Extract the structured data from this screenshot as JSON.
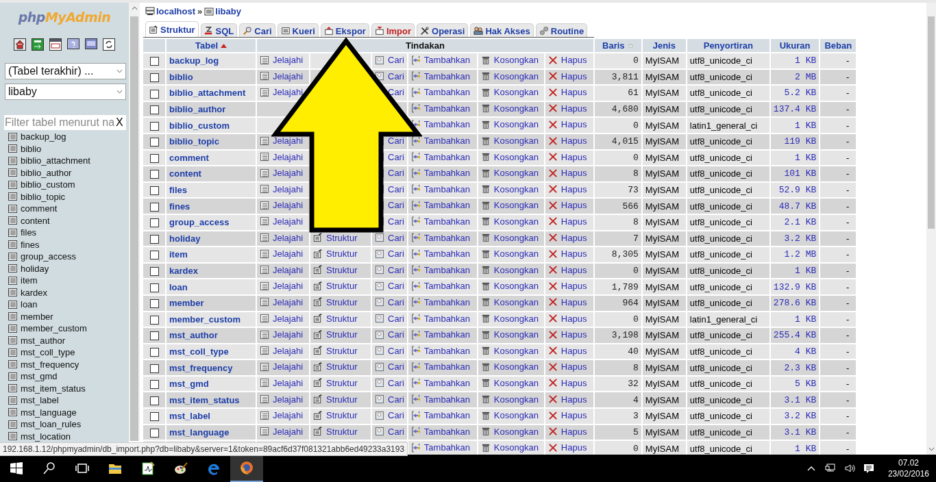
{
  "sidebar": {
    "logo": [
      "php",
      "MyAdmin"
    ],
    "recent_select": "(Tabel terakhir) ...",
    "database_select": "libaby",
    "filter": {
      "placeholder": "Filter tabel menurut na",
      "clear": "X"
    },
    "tables": [
      "backup_log",
      "biblio",
      "biblio_attachment",
      "biblio_author",
      "biblio_custom",
      "biblio_topic",
      "comment",
      "content",
      "files",
      "fines",
      "group_access",
      "holiday",
      "item",
      "kardex",
      "loan",
      "member",
      "member_custom",
      "mst_author",
      "mst_coll_type",
      "mst_frequency",
      "mst_gmd",
      "mst_item_status",
      "mst_label",
      "mst_language",
      "mst_loan_rules",
      "mst_location"
    ]
  },
  "breadcrumb": {
    "server": "localhost",
    "separator": "»",
    "database": "libaby"
  },
  "tabs": [
    {
      "label": "Struktur",
      "selected": true,
      "hovered": false
    },
    {
      "label": "SQL",
      "selected": false,
      "hovered": false
    },
    {
      "label": "Cari",
      "selected": false,
      "hovered": false
    },
    {
      "label": "Kueri",
      "selected": false,
      "hovered": false
    },
    {
      "label": "Ekspor",
      "selected": false,
      "hovered": false
    },
    {
      "label": "Impor",
      "selected": false,
      "hovered": true
    },
    {
      "label": "Operasi",
      "selected": false,
      "hovered": false
    },
    {
      "label": "Hak Akses",
      "selected": false,
      "hovered": false
    },
    {
      "label": "Routine",
      "selected": false,
      "hovered": false
    }
  ],
  "table": {
    "columns": {
      "table": "Tabel",
      "actions": "Tindakan",
      "rows": "Baris",
      "type": "Jenis",
      "collation": "Penyortiran",
      "size": "Ukuran",
      "overhead": "Beban"
    },
    "rows": [
      {
        "checked": false,
        "name": "backup_log",
        "browse": "Jelajahi",
        "search": "Cari",
        "insert": "Tambahkan",
        "empty": "Kosongkan",
        "drop": "Hapus",
        "rows": "0",
        "type": "MyISAM",
        "collation": "utf8_unicode_ci",
        "size": "1 KB",
        "overhead": "-"
      },
      {
        "checked": false,
        "name": "biblio",
        "browse": "Jelajahi",
        "search": "Cari",
        "insert": "Tambahkan",
        "empty": "Kosongkan",
        "drop": "Hapus",
        "rows": "3,811",
        "type": "MyISAM",
        "collation": "utf8_unicode_ci",
        "size": "2 MB",
        "overhead": "-"
      },
      {
        "checked": false,
        "name": "biblio_attachment",
        "browse": "Jelajahi",
        "search": "Cari",
        "insert": "Tambahkan",
        "empty": "Kosongkan",
        "drop": "Hapus",
        "rows": "61",
        "type": "MyISAM",
        "collation": "utf8_unicode_ci",
        "size": "5.2 KB",
        "overhead": "-"
      },
      {
        "checked": false,
        "name": "biblio_author",
        "insert": "Tambahkan",
        "empty": "Kosongkan",
        "drop": "Hapus",
        "rows": "4,680",
        "type": "MyISAM",
        "collation": "utf8_unicode_ci",
        "size": "137.4 KB",
        "overhead": "-"
      },
      {
        "checked": false,
        "name": "biblio_custom",
        "insert": "Tambahkan",
        "empty": "Kosongkan",
        "drop": "Hapus",
        "rows": "0",
        "type": "MyISAM",
        "collation": "latin1_general_ci",
        "size": "1 KB",
        "overhead": "-"
      },
      {
        "checked": false,
        "name": "biblio_topic",
        "browse": "Jelajahi",
        "search": "Cari",
        "insert": "Tambahkan",
        "empty": "Kosongkan",
        "drop": "Hapus",
        "rows": "4,015",
        "type": "MyISAM",
        "collation": "utf8_unicode_ci",
        "size": "119 KB",
        "overhead": "-"
      },
      {
        "checked": false,
        "name": "comment",
        "browse": "Jelajahi",
        "search": "Cari",
        "insert": "Tambahkan",
        "empty": "Kosongkan",
        "drop": "Hapus",
        "rows": "0",
        "type": "MyISAM",
        "collation": "utf8_unicode_ci",
        "size": "1 KB",
        "overhead": "-"
      },
      {
        "checked": false,
        "name": "content",
        "browse": "Jelajahi",
        "search": "Cari",
        "insert": "Tambahkan",
        "empty": "Kosongkan",
        "drop": "Hapus",
        "rows": "8",
        "type": "MyISAM",
        "collation": "utf8_unicode_ci",
        "size": "101 KB",
        "overhead": "-"
      },
      {
        "checked": false,
        "name": "files",
        "browse": "Jelajahi",
        "search": "Cari",
        "insert": "Tambahkan",
        "empty": "Kosongkan",
        "drop": "Hapus",
        "rows": "73",
        "type": "MyISAM",
        "collation": "utf8_unicode_ci",
        "size": "52.9 KB",
        "overhead": "-"
      },
      {
        "checked": false,
        "name": "fines",
        "browse": "Jelajahi",
        "search": "Cari",
        "insert": "Tambahkan",
        "empty": "Kosongkan",
        "drop": "Hapus",
        "rows": "566",
        "type": "MyISAM",
        "collation": "utf8_unicode_ci",
        "size": "48.7 KB",
        "overhead": "-"
      },
      {
        "checked": false,
        "name": "group_access",
        "browse": "Jelajahi",
        "search": "Cari",
        "insert": "Tambahkan",
        "empty": "Kosongkan",
        "drop": "Hapus",
        "rows": "8",
        "type": "MyISAM",
        "collation": "utf8_unicode_ci",
        "size": "2.1 KB",
        "overhead": "-"
      },
      {
        "checked": false,
        "name": "holiday",
        "browse": "Jelajahi",
        "structure": "Struktur",
        "search": "Cari",
        "insert": "Tambahkan",
        "empty": "Kosongkan",
        "drop": "Hapus",
        "rows": "7",
        "type": "MyISAM",
        "collation": "utf8_unicode_ci",
        "size": "3.2 KB",
        "overhead": "-"
      },
      {
        "checked": false,
        "name": "item",
        "browse": "Jelajahi",
        "structure": "Struktur",
        "search": "Cari",
        "insert": "Tambahkan",
        "empty": "Kosongkan",
        "drop": "Hapus",
        "rows": "8,305",
        "type": "MyISAM",
        "collation": "utf8_unicode_ci",
        "size": "1.2 MB",
        "overhead": "-"
      },
      {
        "checked": false,
        "name": "kardex",
        "browse": "Jelajahi",
        "structure": "Struktur",
        "search": "Cari",
        "insert": "Tambahkan",
        "empty": "Kosongkan",
        "drop": "Hapus",
        "rows": "0",
        "type": "MyISAM",
        "collation": "utf8_unicode_ci",
        "size": "1 KB",
        "overhead": "-"
      },
      {
        "checked": false,
        "name": "loan",
        "browse": "Jelajahi",
        "structure": "Struktur",
        "search": "Cari",
        "insert": "Tambahkan",
        "empty": "Kosongkan",
        "drop": "Hapus",
        "rows": "1,789",
        "type": "MyISAM",
        "collation": "utf8_unicode_ci",
        "size": "132.9 KB",
        "overhead": "-"
      },
      {
        "checked": false,
        "name": "member",
        "browse": "Jelajahi",
        "structure": "Struktur",
        "search": "Cari",
        "insert": "Tambahkan",
        "empty": "Kosongkan",
        "drop": "Hapus",
        "rows": "964",
        "type": "MyISAM",
        "collation": "utf8_unicode_ci",
        "size": "278.6 KB",
        "overhead": "-"
      },
      {
        "checked": false,
        "name": "member_custom",
        "browse": "Jelajahi",
        "structure": "Struktur",
        "search": "Cari",
        "insert": "Tambahkan",
        "empty": "Kosongkan",
        "drop": "Hapus",
        "rows": "0",
        "type": "MyISAM",
        "collation": "latin1_general_ci",
        "size": "1 KB",
        "overhead": "-"
      },
      {
        "checked": false,
        "name": "mst_author",
        "browse": "Jelajahi",
        "structure": "Struktur",
        "search": "Cari",
        "insert": "Tambahkan",
        "empty": "Kosongkan",
        "drop": "Hapus",
        "rows": "3,198",
        "type": "MyISAM",
        "collation": "utf8_unicode_ci",
        "size": "255.4 KB",
        "overhead": "-"
      },
      {
        "checked": false,
        "name": "mst_coll_type",
        "browse": "Jelajahi",
        "structure": "Struktur",
        "search": "Cari",
        "insert": "Tambahkan",
        "empty": "Kosongkan",
        "drop": "Hapus",
        "rows": "40",
        "type": "MyISAM",
        "collation": "utf8_unicode_ci",
        "size": "4 KB",
        "overhead": "-"
      },
      {
        "checked": false,
        "name": "mst_frequency",
        "browse": "Jelajahi",
        "structure": "Struktur",
        "search": "Cari",
        "insert": "Tambahkan",
        "empty": "Kosongkan",
        "drop": "Hapus",
        "rows": "8",
        "type": "MyISAM",
        "collation": "utf8_unicode_ci",
        "size": "2.3 KB",
        "overhead": "-"
      },
      {
        "checked": false,
        "name": "mst_gmd",
        "browse": "Jelajahi",
        "structure": "Struktur",
        "search": "Cari",
        "insert": "Tambahkan",
        "empty": "Kosongkan",
        "drop": "Hapus",
        "rows": "32",
        "type": "MyISAM",
        "collation": "utf8_unicode_ci",
        "size": "5 KB",
        "overhead": "-"
      },
      {
        "checked": false,
        "name": "mst_item_status",
        "browse": "Jelajahi",
        "structure": "Struktur",
        "search": "Cari",
        "insert": "Tambahkan",
        "empty": "Kosongkan",
        "drop": "Hapus",
        "rows": "4",
        "type": "MyISAM",
        "collation": "utf8_unicode_ci",
        "size": "3.1 KB",
        "overhead": "-"
      },
      {
        "checked": false,
        "name": "mst_label",
        "browse": "Jelajahi",
        "structure": "Struktur",
        "search": "Cari",
        "insert": "Tambahkan",
        "empty": "Kosongkan",
        "drop": "Hapus",
        "rows": "3",
        "type": "MyISAM",
        "collation": "utf8_unicode_ci",
        "size": "3.2 KB",
        "overhead": "-"
      },
      {
        "checked": false,
        "name": "mst_language",
        "browse": "Jelajahi",
        "structure": "Struktur",
        "search": "Cari",
        "insert": "Tambahkan",
        "empty": "Kosongkan",
        "drop": "Hapus",
        "rows": "5",
        "type": "MyISAM",
        "collation": "utf8_unicode_ci",
        "size": "3.1 KB",
        "overhead": "-"
      },
      {
        "insert": "Tambahkan",
        "empty": "Kosongkan",
        "drop": "Hapus",
        "rows": "0",
        "type": "MyISAM",
        "collation": "utf8_unicode_ci",
        "size": "1 KB",
        "overhead": "-"
      }
    ]
  },
  "status_url": "192.168.1.12/phpmyadmin/db_import.php?db=libaby&server=1&token=89acf6d37f081321abb6ed49233a3193",
  "taskbar": {
    "apps": [
      {
        "selected": false
      },
      {
        "selected": false
      },
      {
        "selected": false
      },
      {
        "selected": false
      },
      {
        "selected": true
      }
    ],
    "time": "07.02",
    "date": "23/02/2016"
  }
}
